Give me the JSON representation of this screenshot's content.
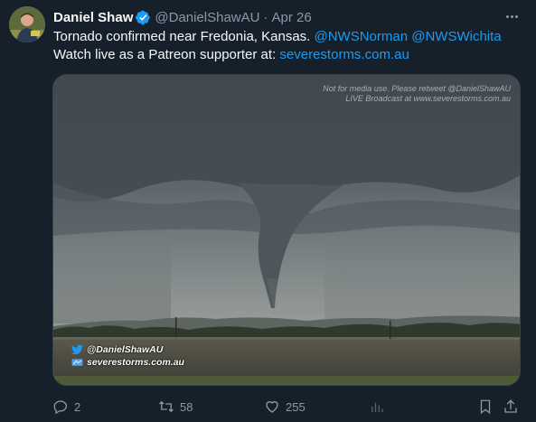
{
  "author": {
    "name": "Daniel Shaw",
    "handle": "@DanielShawAU",
    "separator": "·",
    "date": "Apr 26"
  },
  "tweet": {
    "line1_text": "Tornado confirmed near Fredonia, Kansas. ",
    "mention_1": "@NWSNorman",
    "mention_2": "@NWSWichita",
    "line2_text": "Watch live as a Patreon supporter at: ",
    "link": "severestorms.com.au"
  },
  "media": {
    "watermark_line1": "Not for media use. Please retweet @DanielShawAU",
    "watermark_line2": "LIVE Broadcast at www.severestorms.com.au",
    "overlay_handle": "@DanielShawAU",
    "overlay_site": "severestorms.com.au"
  },
  "actions": {
    "replies": "2",
    "retweets": "58",
    "likes": "255"
  },
  "colors": {
    "background": "#15202b",
    "accent": "#1d9bf0",
    "muted": "#8b98a5"
  },
  "icons": [
    "verified-badge-icon",
    "more-options-icon",
    "reply-icon",
    "retweet-icon",
    "like-icon",
    "views-icon",
    "bookmark-icon",
    "share-icon",
    "twitter-bird-icon"
  ]
}
